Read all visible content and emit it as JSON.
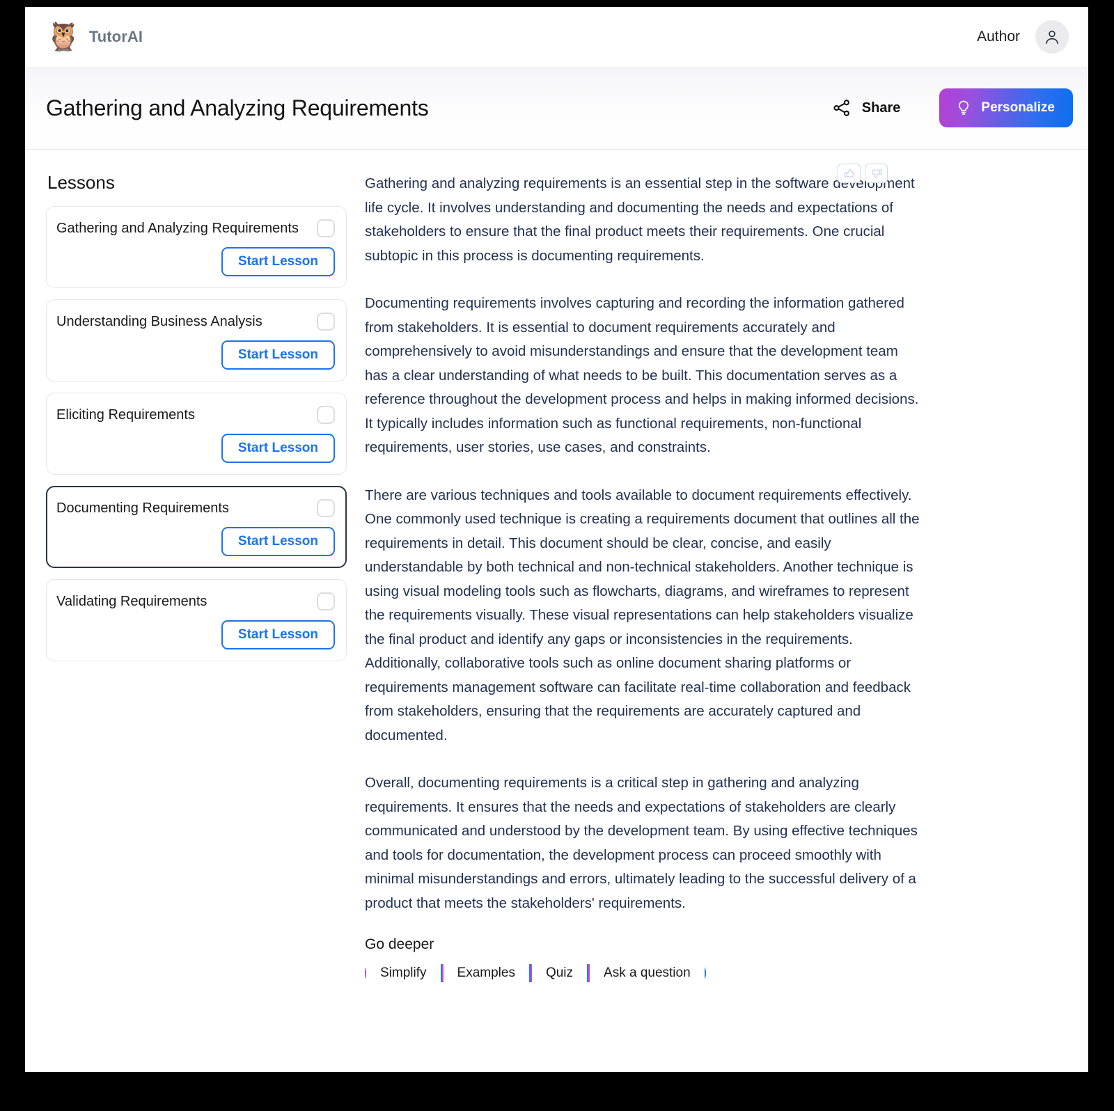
{
  "header": {
    "brand_name": "TutorAI",
    "owl_icon": "owl-icon",
    "author_label": "Author",
    "avatar_icon": "person-icon"
  },
  "titlebar": {
    "title": "Gathering and Analyzing Requirements",
    "share_label": "Share",
    "share_icon": "share-icon",
    "personalize_label": "Personalize",
    "personalize_icon": "lightbulb-icon",
    "personalize_gradient_start": "#b53fd6",
    "personalize_gradient_end": "#0b6fee"
  },
  "sidebar": {
    "heading": "Lessons",
    "start_lesson_label": "Start Lesson",
    "lessons": [
      {
        "title": "Gathering and Analyzing Requirements",
        "selected": false,
        "completed": false
      },
      {
        "title": "Understanding Business Analysis",
        "selected": false,
        "completed": false
      },
      {
        "title": "Eliciting Requirements",
        "selected": false,
        "completed": false
      },
      {
        "title": "Documenting Requirements",
        "selected": true,
        "completed": false
      },
      {
        "title": "Validating Requirements",
        "selected": false,
        "completed": false
      }
    ]
  },
  "feedback": {
    "thumbs_up_icon": "thumbs-up-icon",
    "thumbs_down_icon": "thumbs-down-icon"
  },
  "article": {
    "paragraphs": [
      "Gathering and analyzing requirements is an essential step in the software development life cycle. It involves understanding and documenting the needs and expectations of stakeholders to ensure that the final product meets their requirements. One crucial subtopic in this process is documenting requirements.",
      "Documenting requirements involves capturing and recording the information gathered from stakeholders. It is essential to document requirements accurately and comprehensively to avoid misunderstandings and ensure that the development team has a clear understanding of what needs to be built. This documentation serves as a reference throughout the development process and helps in making informed decisions. It typically includes information such as functional requirements, non-functional requirements, user stories, use cases, and constraints.",
      "There are various techniques and tools available to document requirements effectively. One commonly used technique is creating a requirements document that outlines all the requirements in detail. This document should be clear, concise, and easily understandable by both technical and non-technical stakeholders. Another technique is using visual modeling tools such as flowcharts, diagrams, and wireframes to represent the requirements visually. These visual representations can help stakeholders visualize the final product and identify any gaps or inconsistencies in the requirements. Additionally, collaborative tools such as online document sharing platforms or requirements management software can facilitate real-time collaboration and feedback from stakeholders, ensuring that the requirements are accurately captured and documented.",
      "Overall, documenting requirements is a critical step in gathering and analyzing requirements. It ensures that the needs and expectations of stakeholders are clearly communicated and understood by the development team. By using effective techniques and tools for documentation, the development process can proceed smoothly with minimal misunderstandings and errors, ultimately leading to the successful delivery of a product that meets the stakeholders' requirements."
    ]
  },
  "go_deeper": {
    "heading": "Go deeper",
    "buttons": [
      {
        "label": "Simplify"
      },
      {
        "label": "Examples"
      },
      {
        "label": "Quiz"
      },
      {
        "label": "Ask a question"
      }
    ]
  },
  "colors": {
    "accent_blue": "#1a73f0",
    "body_text": "#223252",
    "brand_gray": "#6b7785",
    "selected_border": "#2b3440"
  }
}
